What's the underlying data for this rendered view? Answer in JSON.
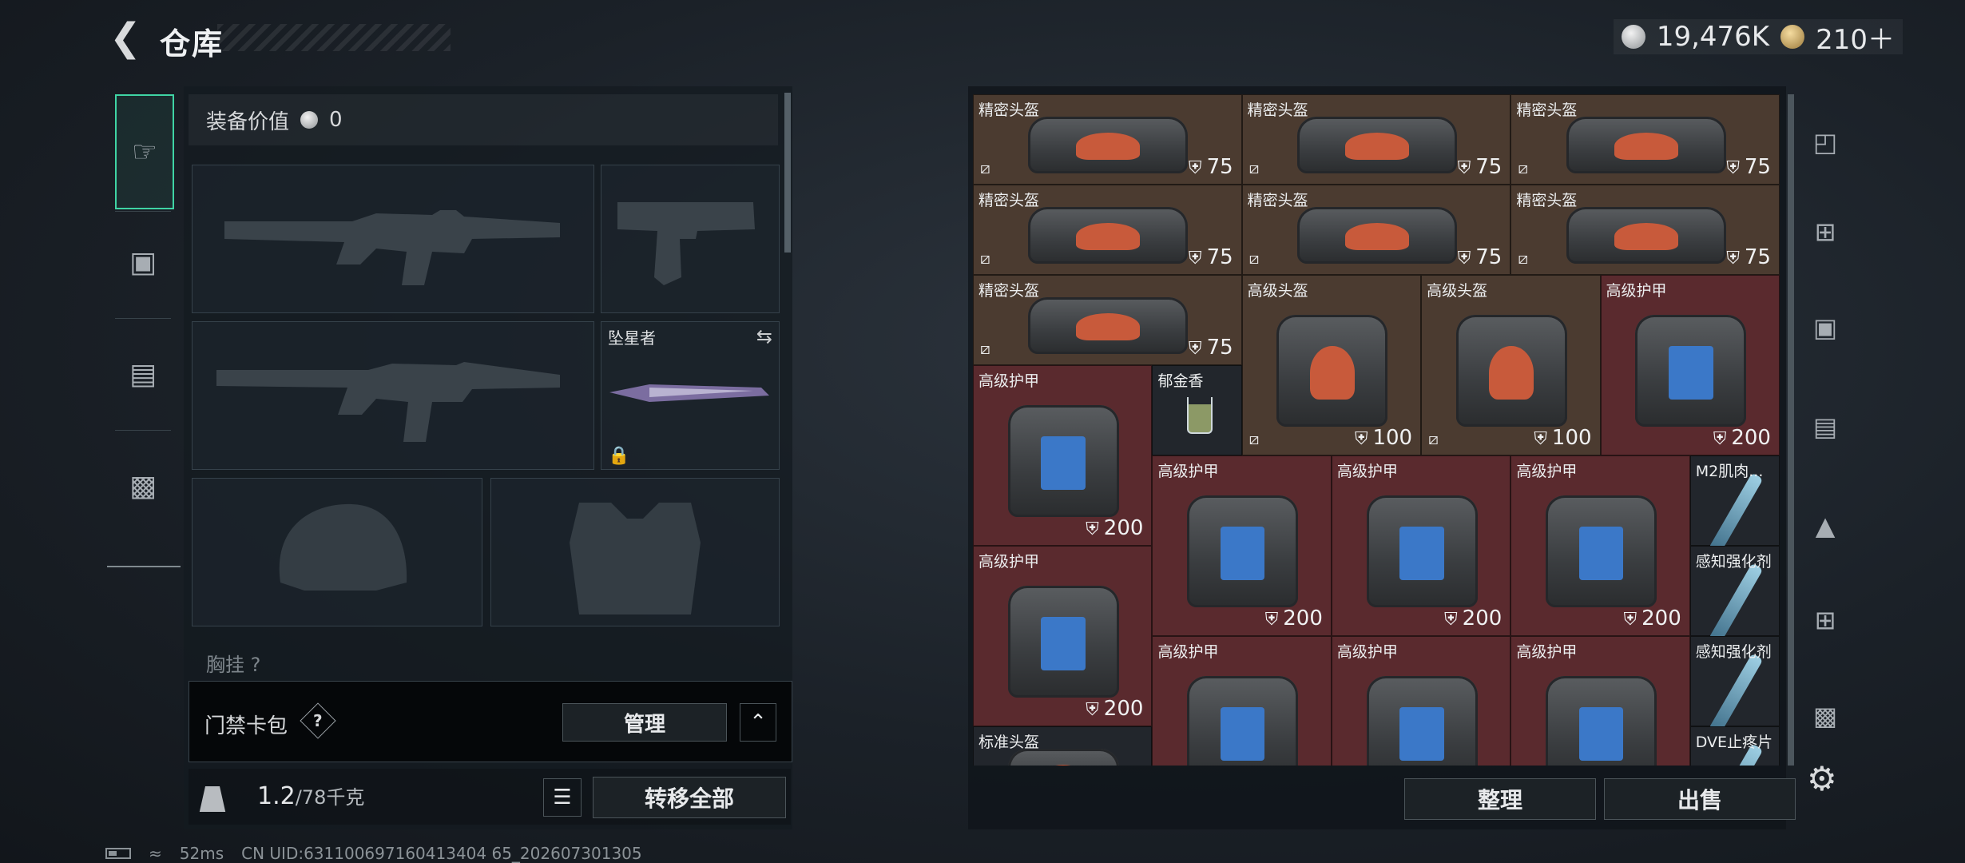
{
  "header": {
    "back_icon": "chevron-left-icon",
    "title": "仓库"
  },
  "currency": {
    "silver": "19,476K",
    "gold": "210＋"
  },
  "left_tabs": [
    {
      "icon": "pistol-icon",
      "active": true
    },
    {
      "icon": "backpack-icon",
      "active": false
    },
    {
      "icon": "vest-icon",
      "active": false
    },
    {
      "icon": "briefcase-icon",
      "active": false
    }
  ],
  "equipment": {
    "value_label": "装备价值",
    "value": "0",
    "melee_label": "坠星者",
    "chest_label": "胸挂 ?"
  },
  "card_pack": {
    "label": "门禁卡包",
    "help": "?",
    "manage_label": "管理",
    "collapse_icon": "chevron-up-icon"
  },
  "weight": {
    "current": "1.2",
    "max": "/78千克"
  },
  "actions": {
    "transfer_all": "转移全部",
    "sort": "整理",
    "sell": "出售"
  },
  "items": [
    {
      "name": "精密头盔",
      "value": "75",
      "kind": "helmet"
    },
    {
      "name": "精密头盔",
      "value": "75",
      "kind": "helmet"
    },
    {
      "name": "精密头盔",
      "value": "75",
      "kind": "helmet"
    },
    {
      "name": "精密头盔",
      "value": "75",
      "kind": "helmet"
    },
    {
      "name": "精密头盔",
      "value": "75",
      "kind": "helmet"
    },
    {
      "name": "精密头盔",
      "value": "75",
      "kind": "helmet"
    },
    {
      "name": "精密头盔",
      "value": "75",
      "kind": "helmet"
    },
    {
      "name": "高级头盔",
      "value": "100",
      "kind": "helmet"
    },
    {
      "name": "高级头盔",
      "value": "100",
      "kind": "helmet"
    },
    {
      "name": "高级护甲",
      "value": "200",
      "kind": "armor"
    },
    {
      "name": "高级护甲",
      "value": "200",
      "kind": "armor"
    },
    {
      "name": "郁金香",
      "value": "",
      "kind": "drink"
    },
    {
      "name": "高级护甲",
      "value": "200",
      "kind": "armor"
    },
    {
      "name": "高级护甲",
      "value": "200",
      "kind": "armor"
    },
    {
      "name": "高级护甲",
      "value": "200",
      "kind": "armor"
    },
    {
      "name": "M2肌肉...",
      "value": "",
      "kind": "syringe"
    },
    {
      "name": "高级护甲",
      "value": "200",
      "kind": "armor"
    },
    {
      "name": "感知强化剂",
      "value": "",
      "kind": "syringe"
    },
    {
      "name": "高级护甲",
      "value": "",
      "kind": "armor"
    },
    {
      "name": "高级护甲",
      "value": "",
      "kind": "armor"
    },
    {
      "name": "高级护甲",
      "value": "",
      "kind": "armor"
    },
    {
      "name": "感知强化剂",
      "value": "",
      "kind": "syringe"
    },
    {
      "name": "标准头盔",
      "value": "",
      "kind": "helmet"
    },
    {
      "name": "DVE止疼片",
      "value": "",
      "kind": "syringe"
    }
  ],
  "right_tabs": [
    "helmet-slot-icon",
    "add-case-icon",
    "case-iv-icon",
    "case-iv-b-icon",
    "case-iii-icon",
    "add-case-b-icon",
    "case-iii-b-icon"
  ],
  "footer": {
    "ping": "52ms",
    "uid": "CN UID:631100697160413404 65_202607301305"
  },
  "colors": {
    "accent": "#3fd4a4",
    "helmet_bg": "#4b3b30",
    "armor_bg": "#5a2a2e"
  }
}
